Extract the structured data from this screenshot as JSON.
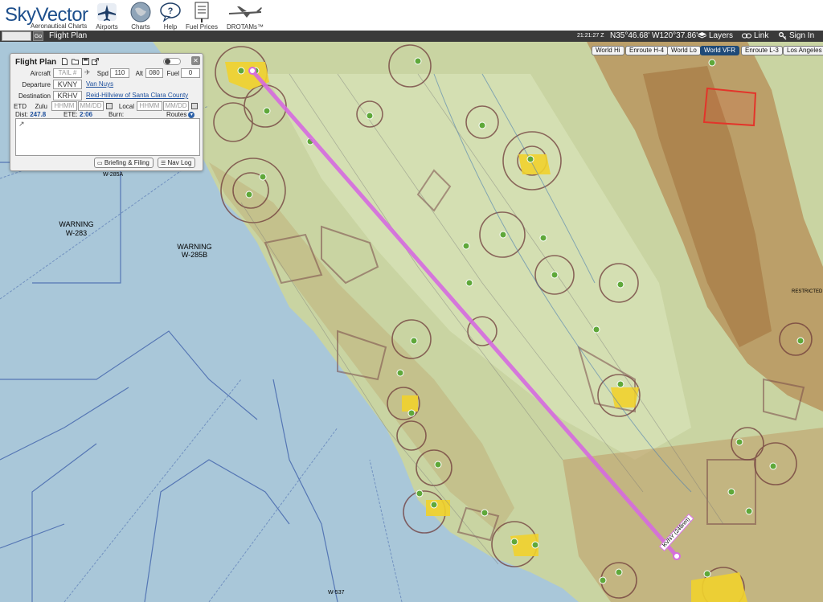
{
  "header": {
    "logo_text": "SkyVector",
    "logo_subtitle": "Aeronautical Charts",
    "nav": [
      {
        "label": "Airports",
        "icon": "airplane-icon"
      },
      {
        "label": "Charts",
        "icon": "globe-icon"
      },
      {
        "label": "Help",
        "icon": "speech-bubble-icon"
      },
      {
        "label": "Fuel Prices",
        "icon": "fuel-sign-icon"
      },
      {
        "label": "DROTAMs™",
        "icon": "drone-icon"
      }
    ]
  },
  "toolbar": {
    "search_value": "",
    "go_label": "Go",
    "flight_plan_label": "Flight Plan",
    "time": "21:21:27 Z",
    "coordinates": "N35°46.68' W120°37.86'",
    "layers_label": "Layers",
    "link_label": "Link",
    "signin_label": "Sign In"
  },
  "chart_types": [
    {
      "label": "World Hi",
      "active": false
    },
    {
      "label": "Enroute H-4",
      "active": false
    },
    {
      "label": "World Lo",
      "active": false
    },
    {
      "label": "World VFR",
      "active": true
    },
    {
      "label": "Enroute L-3",
      "active": false
    },
    {
      "label": "Los Angeles",
      "active": false
    }
  ],
  "flight_plan": {
    "title": "Flight Plan",
    "aircraft_label": "Aircraft",
    "aircraft_placeholder": "TAIL #",
    "spd_label": "Spd",
    "spd_value": "110",
    "alt_label": "Alt",
    "alt_value": "080",
    "fuel_label": "Fuel",
    "fuel_value": "0",
    "departure_label": "Departure",
    "departure_code": "KVNY",
    "departure_name": "Van Nuys",
    "destination_label": "Destination",
    "destination_code": "KRHV",
    "destination_name": "Reid-Hillview of Santa Clara County",
    "etd_label": "ETD",
    "zulu_label": "Zulu",
    "zulu_time_placeholder": "HHMM",
    "zulu_date_placeholder": "MM/DD",
    "local_label": "Local",
    "local_time_placeholder": "HHMM",
    "local_date_placeholder": "MM/DD",
    "dist_label": "Dist:",
    "dist_value": "247.8",
    "ete_label": "ETE:",
    "ete_value": "2:06",
    "burn_label": "Burn:",
    "routes_label": "Routes",
    "route_arrow": "↗",
    "briefing_label": "Briefing & Filing",
    "navlog_label": "Nav Log"
  },
  "map": {
    "warning_labels": [
      {
        "line1": "WARNING",
        "line2": "W-283"
      },
      {
        "line1": "WARNING",
        "line2": "W-285B"
      }
    ],
    "small_labels": [
      "W-285A",
      "W-537",
      "RESTRICTED"
    ],
    "route_length_label": "KVNY (248nm)",
    "colors": {
      "ocean": "#a9c7d9",
      "land": "#c9d4a2",
      "mountains": "#b8955f",
      "route": "#d66be0",
      "airspace": "#7a4a4a",
      "airport": "#5fa83a"
    }
  }
}
